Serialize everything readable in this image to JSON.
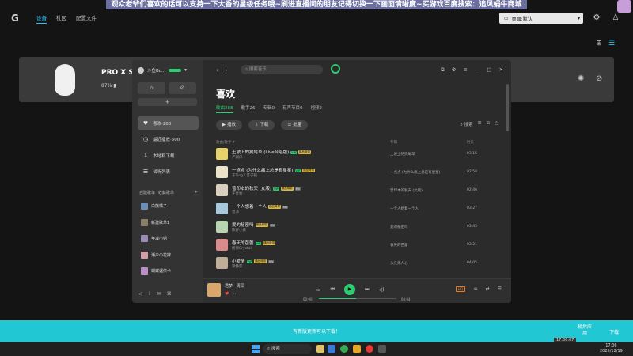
{
  "banner": {
    "text": "观众老爷们喜欢的话可以支持一下大香的星级任务哦~刷进直播间的朋友记得切换一下画面清晰度~买游戏百度搜索：追风蜗牛商城"
  },
  "ghub": {
    "logo": "G",
    "nav": [
      "设备",
      "社区",
      "配置文件"
    ],
    "profile_select": "桌面:默认",
    "device": {
      "name": "PRO X SU",
      "battery": "87%"
    }
  },
  "music": {
    "user": "斗鱼Bo...",
    "side_items": [
      {
        "icon": "heart-icon",
        "glyph": "♥",
        "label": "喜欢·288"
      },
      {
        "icon": "clock-icon",
        "glyph": "◷",
        "label": "最近播放·500"
      },
      {
        "icon": "download-icon",
        "glyph": "⇩",
        "label": "本地和下载"
      },
      {
        "icon": "list-icon",
        "glyph": "☰",
        "label": "试听列表"
      }
    ],
    "side_tabs": {
      "created": "自建歌单",
      "collected": "收藏歌单",
      "add": "+"
    },
    "playlists": [
      {
        "name": "白熊橘子",
        "color": "#6a8fb3"
      },
      {
        "name": "新建歌单1",
        "color": "#8c7f6a"
      },
      {
        "name": "苹减小姐",
        "color": "#9b8cb7"
      },
      {
        "name": "瀬户の花嫁",
        "color": "#d1a0a6"
      },
      {
        "name": "蝴蝶遇依卡",
        "color": "#b98fc8"
      }
    ],
    "search_placeholder": "搜索音乐",
    "heading": "喜欢",
    "tabs": [
      "歌曲288",
      "歌手26",
      "专辑0",
      "有声节目0",
      "视频2"
    ],
    "actions": {
      "play": "播放",
      "download": "下载",
      "batch": "批量"
    },
    "tools": {
      "search": "搜索"
    },
    "columns": {
      "song": "歌曲/歌手 ↑",
      "album": "专辑",
      "duration": "时长"
    },
    "songs": [
      {
        "title": "土坡上的狗尾草 (Live合唱版)",
        "artist": "卢润泽",
        "album": "土坡上的狗尾草",
        "duration": "03:15",
        "color": "#e8d26b",
        "badges": [
          "VIP",
          "臻品母带"
        ]
      },
      {
        "title": "一点点 (为什么痛上总是有星星)",
        "artist": "于Ting / 苏子铭",
        "album": "一点点 (为什么痛上总是有星星)",
        "duration": "02:58",
        "color": "#ece3c9",
        "badges": [
          "VIP",
          "臻品母带"
        ]
      },
      {
        "title": "曾印本的秋天 (女版)",
        "artist": "王优秀",
        "album": "曾印本的秋天 (女版)",
        "duration": "02:46",
        "color": "#d8cfc0",
        "badges": [
          "VIP",
          "臻品母带",
          "MV"
        ]
      },
      {
        "title": "一个人想着一个人",
        "artist": "曾沛",
        "album": "一个人想着一个人",
        "duration": "03:27",
        "color": "#a8c9db",
        "badges": [
          "臻品母带",
          "MV"
        ]
      },
      {
        "title": "爱的秘密吗",
        "artist": "陈好小黄",
        "album": "爱的秘密吗",
        "duration": "03:45",
        "color": "#b8d4b1",
        "badges": [
          "臻品母带",
          "MV"
        ]
      },
      {
        "title": "春天的芭蕾",
        "artist": "杨丽Crystal",
        "album": "春天的芭蕾",
        "duration": "03:21",
        "color": "#d98a8a",
        "badges": [
          "VIP",
          "臻品母带"
        ]
      },
      {
        "title": "小爱情",
        "artist": "梁静茹",
        "album": "永久无人心",
        "duration": "04:05",
        "color": "#bfae9a",
        "badges": [
          "VIP",
          "臻品母带",
          "MV"
        ]
      }
    ],
    "player": {
      "title": "君梦 · 周深",
      "time_current": "00:00",
      "time_total": "04:04",
      "progress": 0.48,
      "quality": "HQ"
    }
  },
  "update_bar": {
    "text": "有新版更新可以下载！",
    "later": "稍后应用",
    "now": "下载"
  },
  "clock_overlay": "17:00:07",
  "taskbar": {
    "search": "搜索",
    "time": "17:06",
    "date": "2025/12/19"
  }
}
